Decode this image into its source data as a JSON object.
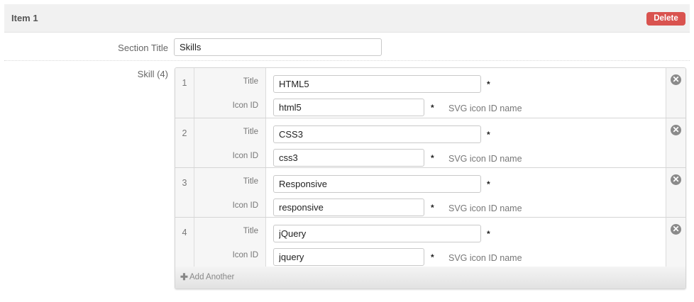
{
  "item": {
    "title": "Item 1",
    "delete_label": "Delete"
  },
  "section": {
    "label": "Section Title",
    "value": "Skills"
  },
  "skills": {
    "label": "Skill (4)",
    "title_label": "Title",
    "icon_label": "Icon ID",
    "required_mark": "*",
    "hint": "SVG icon ID name",
    "remove_icon": "close-circle-icon",
    "rows": [
      {
        "num": "1",
        "title": "HTML5",
        "icon_id": "html5"
      },
      {
        "num": "2",
        "title": "CSS3",
        "icon_id": "css3"
      },
      {
        "num": "3",
        "title": "Responsive",
        "icon_id": "responsive"
      },
      {
        "num": "4",
        "title": "jQuery",
        "icon_id": "jquery"
      }
    ],
    "add_label": "Add Another"
  },
  "colors": {
    "delete": "#d9534f",
    "header_bg": "#f1f1f1",
    "panel_bg": "#f6f6f6"
  }
}
